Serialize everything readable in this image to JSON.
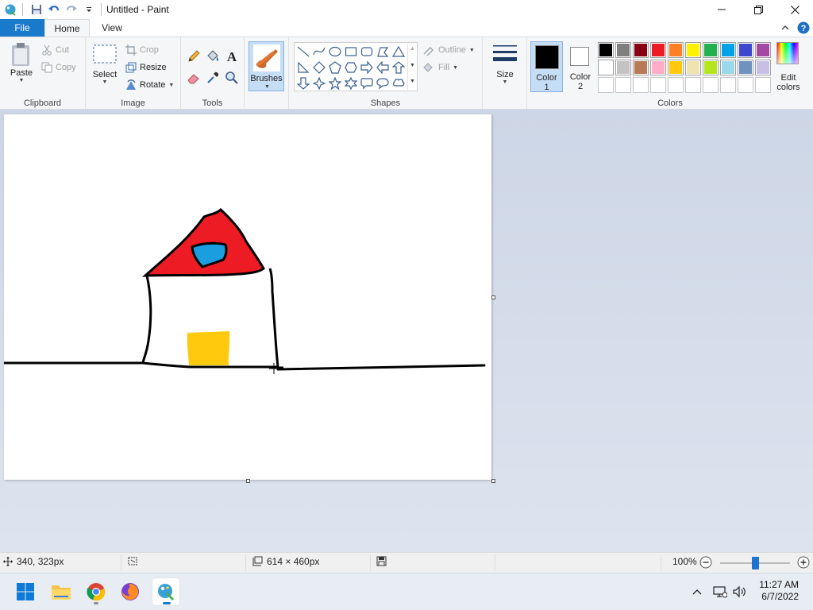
{
  "window": {
    "title": "Untitled - Paint"
  },
  "tabs": {
    "file": "File",
    "home": "Home",
    "view": "View"
  },
  "clipboard": {
    "paste": "Paste",
    "cut": "Cut",
    "copy": "Copy",
    "label": "Clipboard"
  },
  "image": {
    "select": "Select",
    "crop": "Crop",
    "resize": "Resize",
    "rotate": "Rotate",
    "label": "Image"
  },
  "tools": {
    "label": "Tools"
  },
  "brushes": {
    "label": "Brushes"
  },
  "shapes": {
    "outline": "Outline",
    "fill": "Fill",
    "label": "Shapes"
  },
  "size": {
    "label": "Size"
  },
  "colors": {
    "color1_label": "Color",
    "color1_num": "1",
    "color2_label": "Color",
    "color2_num": "2",
    "edit_label_1": "Edit",
    "edit_label_2": "colors",
    "label": "Colors",
    "color1": "#000000",
    "color2": "#ffffff",
    "palette_row1": [
      "#000000",
      "#7f7f7f",
      "#880015",
      "#ed1c24",
      "#ff7f27",
      "#fff200",
      "#22b14c",
      "#00a2e8",
      "#3f48cc",
      "#a349a4"
    ],
    "palette_row2": [
      "#ffffff",
      "#c3c3c3",
      "#b97a57",
      "#ffaec9",
      "#ffc90e",
      "#efe4b0",
      "#b5e61d",
      "#99d9ea",
      "#7092be",
      "#c8bfe7"
    ]
  },
  "status": {
    "cursor_pos": "340, 323px",
    "canvas_size": "614 × 460px",
    "zoom": "100%",
    "zoom_level": 0.5
  },
  "taskbar": {
    "time": "11:27 AM",
    "date": "6/7/2022"
  }
}
